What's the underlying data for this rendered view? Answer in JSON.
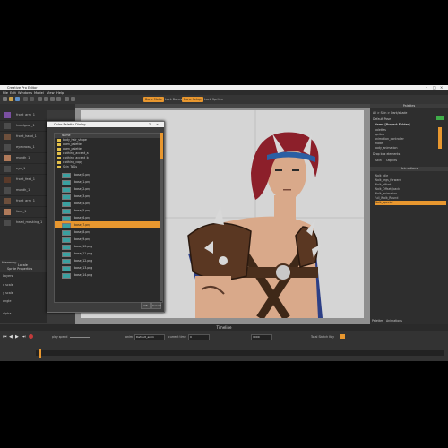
{
  "app": {
    "title": "Creative Pro Editor",
    "menu": [
      "File",
      "Edit",
      "Windows",
      "Model",
      "View",
      "Help"
    ]
  },
  "toolbar": {
    "toggles": [
      {
        "label": "Bone Mode",
        "active": true
      },
      {
        "label": "Lock Bones",
        "active": false
      },
      {
        "label": "Bone Setup",
        "active": true
      },
      {
        "label": "Lock Sprites",
        "active": false
      }
    ]
  },
  "left_panel": {
    "items": [
      "front_arm_1",
      "headgear_1",
      "front_hand_1",
      "eyebrows_1",
      "mouth_1",
      "eye_1",
      "front_feet_1",
      "mouth_1",
      "front_arm_1",
      "face_1",
      "head_masking_1"
    ],
    "tabs": [
      "Hierarchy",
      "Locale",
      "Sprite Properties"
    ],
    "props": [
      "Layers",
      "x scale",
      "y scale",
      "angle",
      "alpha"
    ]
  },
  "dialog": {
    "title": "Color Palette Dialog",
    "header": "Name",
    "tree": [
      "body_hair_shape",
      "open_palette",
      "open_palette",
      "clothing_accent_a",
      "clothing_accent_b",
      "clothing_copy",
      "Skin_ToGu"
    ],
    "files": [
      "base_0.png",
      "base_1.png",
      "base_2.png",
      "base_3.png",
      "base_4.png",
      "base_5.png",
      "base_6.png",
      "base_7.png",
      "base_8.png",
      "base_9.png",
      "base_10.png",
      "base_11.png",
      "base_12.png",
      "base_13.png",
      "base_14.png"
    ],
    "selected_index": 7,
    "buttons": [
      "OK",
      "Cancel"
    ]
  },
  "right_panel": {
    "header": "Palettes",
    "labels": [
      "All > Skin > Dark/shade",
      "Default Pose",
      "Drop box elements"
    ],
    "tabs": [
      "Skin",
      "Objects"
    ],
    "project_header": "Name  [Project Folder]",
    "project_items": [
      "palettes",
      "sprites",
      "animation_controller",
      "mode",
      "body_animation"
    ],
    "animations_header": "Animations",
    "animations": [
      "Walk_Idle",
      "Walk_legs_forward",
      "Walk_offset",
      "Walk_Offset_back",
      "Walk_animation",
      "Full_Walk_Round",
      "Walk_special"
    ],
    "selected_animation": "Walk_special",
    "bottom_tabs": [
      "Palettes",
      "Animations"
    ]
  },
  "timeline": {
    "title": "Timeline",
    "label_speed": "play speed",
    "label_anim": "anim",
    "anim_value": "Default_anim",
    "label_current": "current time",
    "current_value": "0",
    "end_value": "1000",
    "label_interpolation": "Total Sketch Key",
    "controls": [
      "⏮",
      "◀",
      "▶",
      "⏭"
    ]
  },
  "colors": {
    "accent": "#e8972f",
    "canvas": "#d5d5d5"
  }
}
